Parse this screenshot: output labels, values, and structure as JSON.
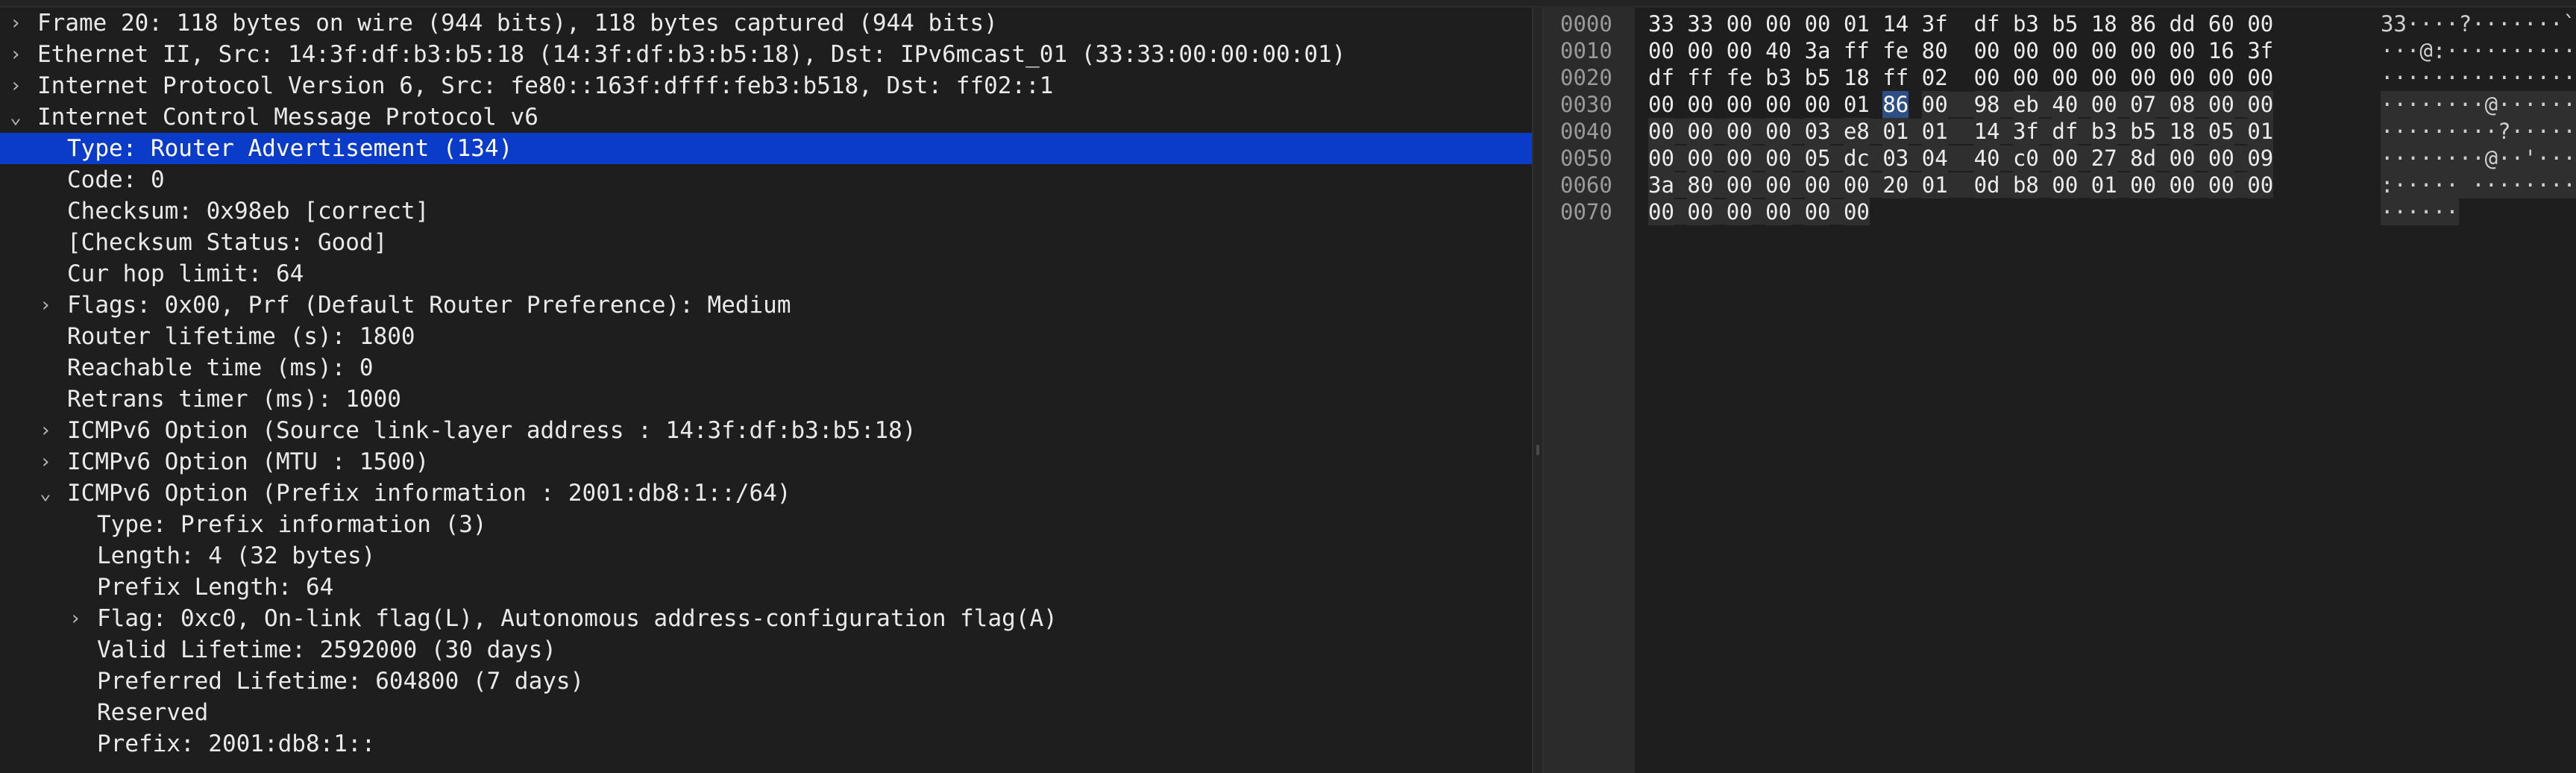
{
  "details": {
    "rows": [
      {
        "arrow": "›",
        "label": "Frame 20: 118 bytes on wire (944 bits), 118 bytes captured (944 bits)"
      },
      {
        "arrow": "›",
        "label": "Ethernet II, Src: 14:3f:df:b3:b5:18 (14:3f:df:b3:b5:18), Dst: IPv6mcast_01 (33:33:00:00:00:01)"
      },
      {
        "arrow": "›",
        "label": "Internet Protocol Version 6, Src: fe80::163f:dfff:feb3:b518, Dst: ff02::1"
      },
      {
        "arrow": "⌄",
        "label": "Internet Control Message Protocol v6"
      },
      {
        "arrow": "",
        "label": "Type: Router Advertisement (134)"
      },
      {
        "arrow": "",
        "label": "Code: 0"
      },
      {
        "arrow": "",
        "label": "Checksum: 0x98eb [correct]"
      },
      {
        "arrow": "",
        "label": "[Checksum Status: Good]"
      },
      {
        "arrow": "",
        "label": "Cur hop limit: 64"
      },
      {
        "arrow": "›",
        "label": "Flags: 0x00, Prf (Default Router Preference): Medium"
      },
      {
        "arrow": "",
        "label": "Router lifetime (s): 1800"
      },
      {
        "arrow": "",
        "label": "Reachable time (ms): 0"
      },
      {
        "arrow": "",
        "label": "Retrans timer (ms): 1000"
      },
      {
        "arrow": "›",
        "label": "ICMPv6 Option (Source link-layer address : 14:3f:df:b3:b5:18)"
      },
      {
        "arrow": "›",
        "label": "ICMPv6 Option (MTU : 1500)"
      },
      {
        "arrow": "⌄",
        "label": "ICMPv6 Option (Prefix information : 2001:db8:1::/64)"
      },
      {
        "arrow": "",
        "label": "Type: Prefix information (3)"
      },
      {
        "arrow": "",
        "label": "Length: 4 (32 bytes)"
      },
      {
        "arrow": "",
        "label": "Prefix Length: 64"
      },
      {
        "arrow": "›",
        "label": "Flag: 0xc0, On-link flag(L), Autonomous address-configuration flag(A)"
      },
      {
        "arrow": "",
        "label": "Valid Lifetime: 2592000 (30 days)"
      },
      {
        "arrow": "",
        "label": "Preferred Lifetime: 604800 (7 days)"
      },
      {
        "arrow": "",
        "label": "Reserved"
      },
      {
        "arrow": "",
        "label": "Prefix: 2001:db8:1::"
      }
    ]
  },
  "bytes": {
    "rows": [
      {
        "offset": "0000",
        "hex": [
          "33",
          "33",
          "00",
          "00",
          "00",
          "01",
          "14",
          "3f",
          "df",
          "b3",
          "b5",
          "18",
          "86",
          "dd",
          "60",
          "00"
        ],
        "ascii": "33····?·······`·"
      },
      {
        "offset": "0010",
        "hex": [
          "00",
          "00",
          "00",
          "40",
          "3a",
          "ff",
          "fe",
          "80",
          "00",
          "00",
          "00",
          "00",
          "00",
          "00",
          "16",
          "3f"
        ],
        "ascii": "···@:··········?"
      },
      {
        "offset": "0020",
        "hex": [
          "df",
          "ff",
          "fe",
          "b3",
          "b5",
          "18",
          "ff",
          "02",
          "00",
          "00",
          "00",
          "00",
          "00",
          "00",
          "00",
          "00"
        ],
        "ascii": "················"
      },
      {
        "offset": "0030",
        "hex": [
          "00",
          "00",
          "00",
          "00",
          "00",
          "01",
          "86",
          "00",
          "98",
          "eb",
          "40",
          "00",
          "07",
          "08",
          "00",
          "00"
        ],
        "ascii": "········@·······"
      },
      {
        "offset": "0040",
        "hex": [
          "00",
          "00",
          "00",
          "00",
          "03",
          "e8",
          "01",
          "01",
          "14",
          "3f",
          "df",
          "b3",
          "b5",
          "18",
          "05",
          "01"
        ],
        "ascii": "·········?······"
      },
      {
        "offset": "0050",
        "hex": [
          "00",
          "00",
          "00",
          "00",
          "05",
          "dc",
          "03",
          "04",
          "40",
          "c0",
          "00",
          "27",
          "8d",
          "00",
          "00",
          "09"
        ],
        "ascii": "········@··'····"
      },
      {
        "offset": "0060",
        "hex": [
          "3a",
          "80",
          "00",
          "00",
          "00",
          "00",
          "20",
          "01",
          "0d",
          "b8",
          "00",
          "01",
          "00",
          "00",
          "00",
          "00"
        ],
        "ascii": ":····· ·········"
      },
      {
        "offset": "0070",
        "hex": [
          "00",
          "00",
          "00",
          "00",
          "00",
          "00"
        ],
        "ascii": "······"
      }
    ]
  },
  "colors": {
    "selected_row": "#0a3cc9",
    "selected_byte": "#2d4f86",
    "field_highlight": "#2f2f2f"
  }
}
